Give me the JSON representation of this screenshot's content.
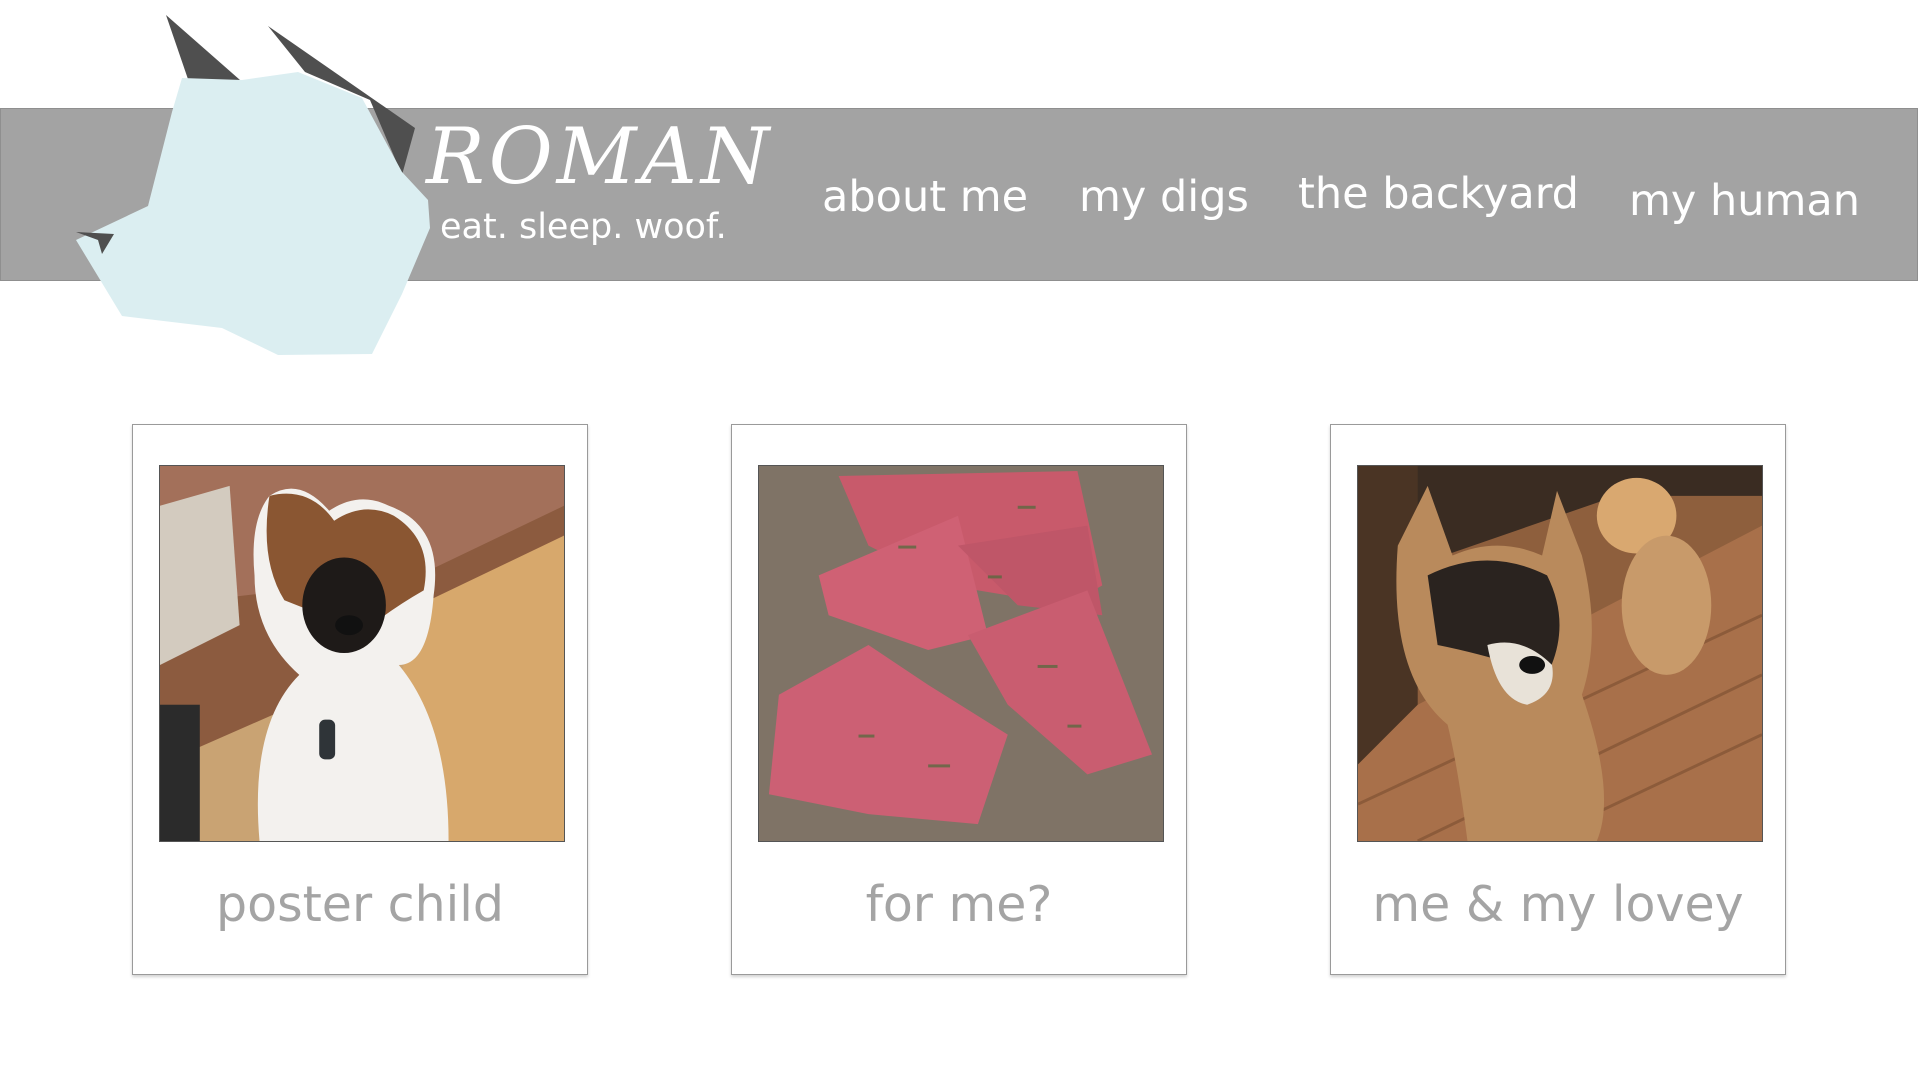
{
  "brand": {
    "name": "ROMAN",
    "tagline": "eat. sleep. woof."
  },
  "nav": {
    "items": [
      {
        "label": "about me"
      },
      {
        "label": "my digs"
      },
      {
        "label": "the backyard"
      },
      {
        "label": "my human"
      }
    ]
  },
  "gallery": {
    "cards": [
      {
        "caption": "poster child",
        "photo": "akita-puppy-photo"
      },
      {
        "caption": "for me?",
        "photo": "raw-steaks-photo"
      },
      {
        "caption": "me & my lovey",
        "photo": "akita-with-plush-toy-photo"
      }
    ]
  },
  "colors": {
    "header_band": "#a3a3a3",
    "logo_face": "#dbeef1",
    "logo_ears": "#4f4f4f",
    "caption_text": "#a4a4a4",
    "nav_text": "#ffffff"
  },
  "icons": {
    "logo": "dog-head-logo-icon"
  }
}
